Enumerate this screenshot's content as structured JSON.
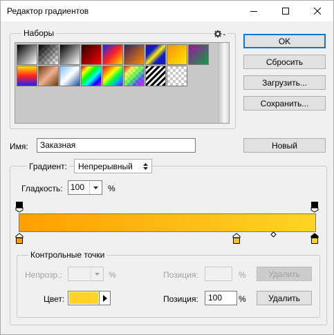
{
  "window": {
    "title": "Редактор градиентов",
    "controls": [
      "minimize-icon",
      "maximize-icon",
      "close-icon"
    ]
  },
  "presets": {
    "legend": "Наборы",
    "menu_icon": "gear-icon"
  },
  "buttons": {
    "ok": "OK",
    "reset": "Сбросить",
    "load": "Загрузить...",
    "save": "Сохранить...",
    "new": "Новый",
    "delete_opacity": "Удалить",
    "delete_color": "Удалить"
  },
  "name": {
    "label": "Имя:",
    "value": "Заказная"
  },
  "gradient": {
    "type_label": "Градиент:",
    "type_value": "Непрерывный",
    "smoothness_label": "Гладкость:",
    "smoothness_value": "100",
    "smoothness_unit": "%",
    "colors": {
      "start": "#ff9f00",
      "end": "#ffd426"
    }
  },
  "stops": {
    "legend": "Контрольные точки",
    "opacity_label": "Непрозр.:",
    "opacity_value": "",
    "opacity_unit": "%",
    "opacity_position_label": "Позиция:",
    "opacity_position_value": "",
    "opacity_position_unit": "%",
    "color_label": "Цвет:",
    "color_value": "#ffd426",
    "color_position_label": "Позиция:",
    "color_position_value": "100",
    "color_position_unit": "%"
  }
}
